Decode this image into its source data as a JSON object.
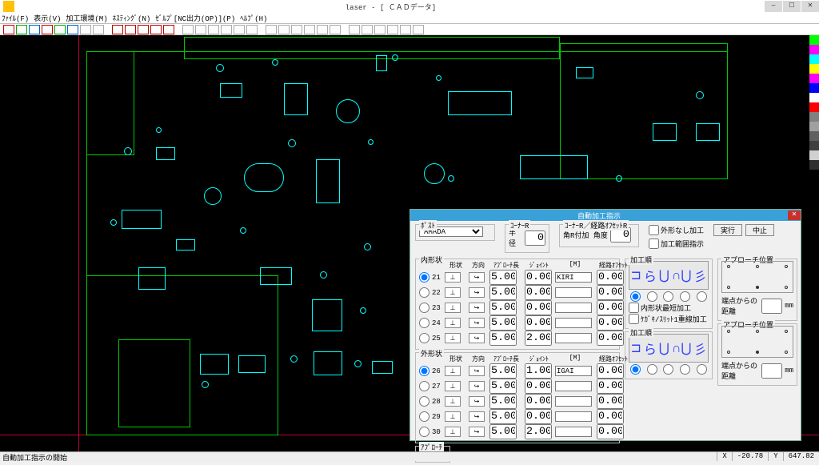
{
  "window": {
    "title": "laser - [ ＣＡＤデータ]",
    "min": "—",
    "max": "☐",
    "close": "✕"
  },
  "menu": [
    "ﾌｧｲﾙ(F)",
    "表示(V)",
    "加工環境(M)",
    "ﾈｽﾃｨﾝｸﾞ(N)",
    "ｾﾞﾙﾌﾟ[NC出力(OP)](P)",
    "ﾍﾙﾌﾟ(H)"
  ],
  "palette_colors": [
    "#00ff00",
    "#ff00ff",
    "#00ffff",
    "#ffff00",
    "#ff00ff",
    "#0000ff",
    "#ffffff",
    "#ff0000",
    "#808080",
    "#a0a0a0",
    "#606060",
    "#404040",
    "#d0d0d0",
    "#303030"
  ],
  "status": {
    "msg": "自動加工指示の開始",
    "x_label": "X",
    "x": "-20.78",
    "y_label": "Y",
    "y": "647.82"
  },
  "dialog": {
    "title": "自動加工指示",
    "post_label": "ﾎﾟｽﾄ",
    "post_value": "AMADA",
    "cornerR_label": "ｺｰﾅｰR",
    "radius_label": "半径",
    "radius_value": "0",
    "offsetR_label": "ｺｰﾅｰR／経路ｵﾌｾｯﾄR",
    "angleR_label": "角R付加 角度",
    "angleR_value": "0",
    "chk_no_outer": "外形なし加工",
    "chk_range": "加工範囲指示",
    "exec": "実行",
    "cancel": "中止",
    "inner_label": "内形状",
    "outer_label": "外形状",
    "hdr": {
      "shape": "形状",
      "dir": "方向",
      "approach": "ｱﾌﾟﾛｰﾁ長",
      "joint": "ｼﾞｮｲﾝﾄ",
      "m": "[M]",
      "offset": "経路ｵﾌｾｯﾄ"
    },
    "inner_rows": [
      {
        "id": "21",
        "ap": "5.00",
        "jt": "0.00",
        "m": "KIRI",
        "off": "0.000",
        "checked": true
      },
      {
        "id": "22",
        "ap": "5.00",
        "jt": "0.00",
        "m": "",
        "off": "0.000"
      },
      {
        "id": "23",
        "ap": "5.00",
        "jt": "0.00",
        "m": "",
        "off": "0.000"
      },
      {
        "id": "24",
        "ap": "5.00",
        "jt": "0.00",
        "m": "",
        "off": "0.000"
      },
      {
        "id": "25",
        "ap": "5.00",
        "jt": "2.00",
        "m": "",
        "off": "0.000"
      }
    ],
    "outer_rows": [
      {
        "id": "26",
        "ap": "5.00",
        "jt": "1.00",
        "m": "IGAI",
        "off": "0.000",
        "checked": true
      },
      {
        "id": "27",
        "ap": "5.00",
        "jt": "0.00",
        "m": "",
        "off": "0.000"
      },
      {
        "id": "28",
        "ap": "5.00",
        "jt": "0.00",
        "m": "",
        "off": "0.000"
      },
      {
        "id": "29",
        "ap": "5.00",
        "jt": "0.00",
        "m": "",
        "off": "0.000"
      },
      {
        "id": "30",
        "ap": "5.00",
        "jt": "2.00",
        "m": "",
        "off": "0.000"
      }
    ],
    "proc_order": "加工順",
    "chk_shortest": "内形状最短加工",
    "chk_kegaki": "ｹｶﾞｷ/ｽﾘｯﾄ1重線加工",
    "approach_pos": "アプローチ位置",
    "dist_label": "端点からの距離",
    "dist_unit": "mm",
    "approach_btn": "ｱﾌﾟﾛｰﾁ",
    "shape_btn": "⬜",
    "dir_btn": "↪"
  }
}
